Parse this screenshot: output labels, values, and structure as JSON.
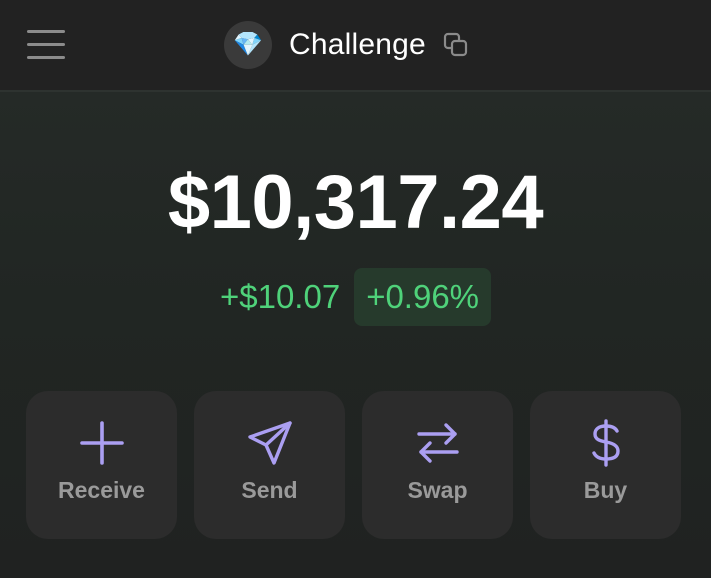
{
  "header": {
    "account_emoji": "💎",
    "account_name": "Challenge"
  },
  "portfolio": {
    "balance": "$10,317.24",
    "change_amount": "+$10.07",
    "change_percent": "+0.96%"
  },
  "actions": [
    {
      "label": "Receive",
      "icon": "plus-icon"
    },
    {
      "label": "Send",
      "icon": "send-icon"
    },
    {
      "label": "Swap",
      "icon": "swap-icon"
    },
    {
      "label": "Buy",
      "icon": "dollar-icon"
    }
  ],
  "colors": {
    "accent": "#ab9ff2",
    "positive": "#4fd27a",
    "positive_bg": "#263a2c",
    "card": "#2c2c2c",
    "header": "#222222"
  }
}
